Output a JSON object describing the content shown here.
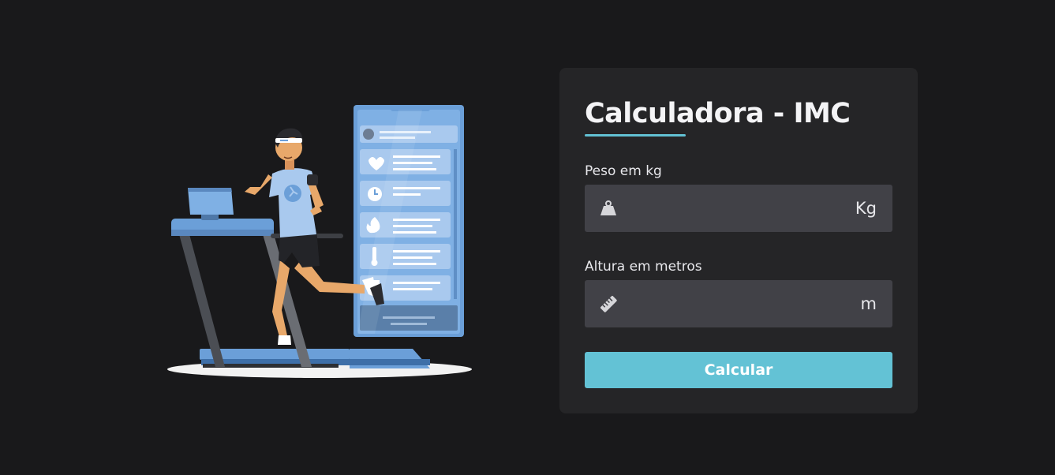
{
  "form": {
    "title": "Calculadora - IMC",
    "weight": {
      "label": "Peso em kg",
      "value": "",
      "placeholder": "",
      "unit": "Kg",
      "icon": "weight-icon"
    },
    "height": {
      "label": "Altura em metros",
      "value": "",
      "placeholder": "",
      "unit": "m",
      "icon": "ruler-icon"
    },
    "submit_label": "Calcular"
  },
  "colors": {
    "background": "#19191b",
    "card": "#252527",
    "input": "#414147",
    "accent": "#63c2d5",
    "illustration_blue": "#6b9fd8"
  }
}
